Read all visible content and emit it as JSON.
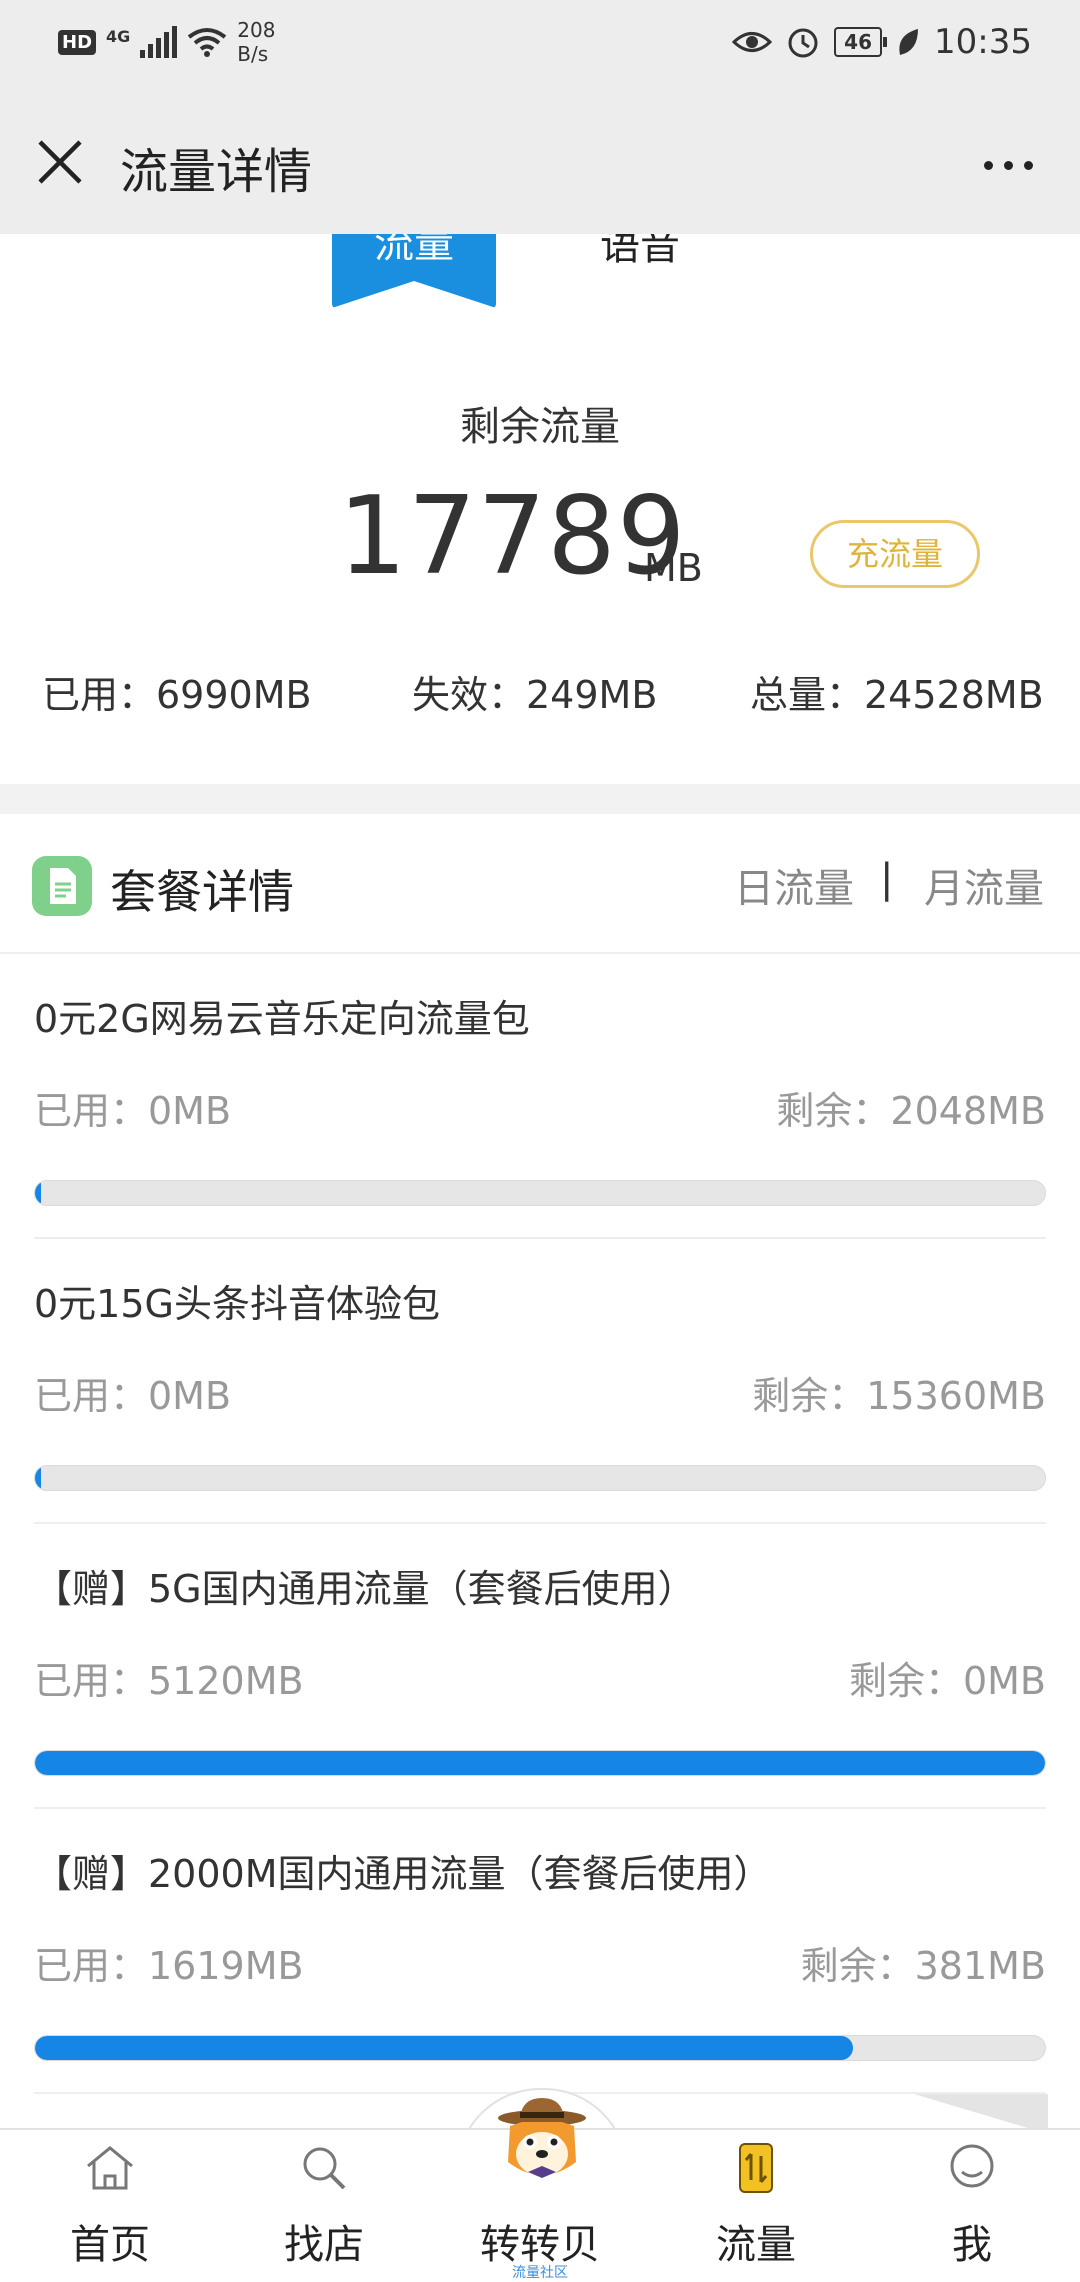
{
  "status_bar": {
    "hd": "HD",
    "network": "4G",
    "speed_value": "208",
    "speed_unit": "B/s",
    "battery": "46",
    "time": "10:35"
  },
  "header": {
    "title": "流量详情"
  },
  "tabs": {
    "flow": "流量",
    "voice": "语音"
  },
  "summary": {
    "label": "剩余流量",
    "value": "17789",
    "unit": "MB",
    "recharge_label": "充流量",
    "used": "已用：6990MB",
    "expired": "失效：249MB",
    "total": "总量：24528MB"
  },
  "packages": {
    "title": "套餐详情",
    "tab_day": "日流量",
    "separator": "|",
    "tab_month": "月流量",
    "items": [
      {
        "name": "0元2G网易云音乐定向流量包",
        "used": "已用：0MB",
        "remain": "剩余：2048MB",
        "progress": 0.0
      },
      {
        "name": "0元15G头条抖音体验包",
        "used": "已用：0MB",
        "remain": "剩余：15360MB",
        "progress": 0.0
      },
      {
        "name": "【赠】5G国内通用流量（套餐后使用）",
        "used": "已用：5120MB",
        "remain": "剩余：0MB",
        "progress": 1.0
      },
      {
        "name": "【赠】2000M国内通用流量（套餐后使用）",
        "used": "已用：1619MB",
        "remain": "剩余：381MB",
        "progress": 0.81
      }
    ]
  },
  "bottom_nav": [
    {
      "label": "首页",
      "icon": "home-icon"
    },
    {
      "label": "找店",
      "icon": "search-icon"
    },
    {
      "label": "转转贝",
      "icon": "mascot-icon"
    },
    {
      "label": "流量",
      "icon": "flow-icon"
    },
    {
      "label": "我",
      "icon": "user-icon"
    }
  ],
  "mascot_caption": "流量社区",
  "colors": {
    "accent": "#1585e6",
    "recharge": "#e0b33a",
    "doc_icon": "#7fd08a"
  }
}
